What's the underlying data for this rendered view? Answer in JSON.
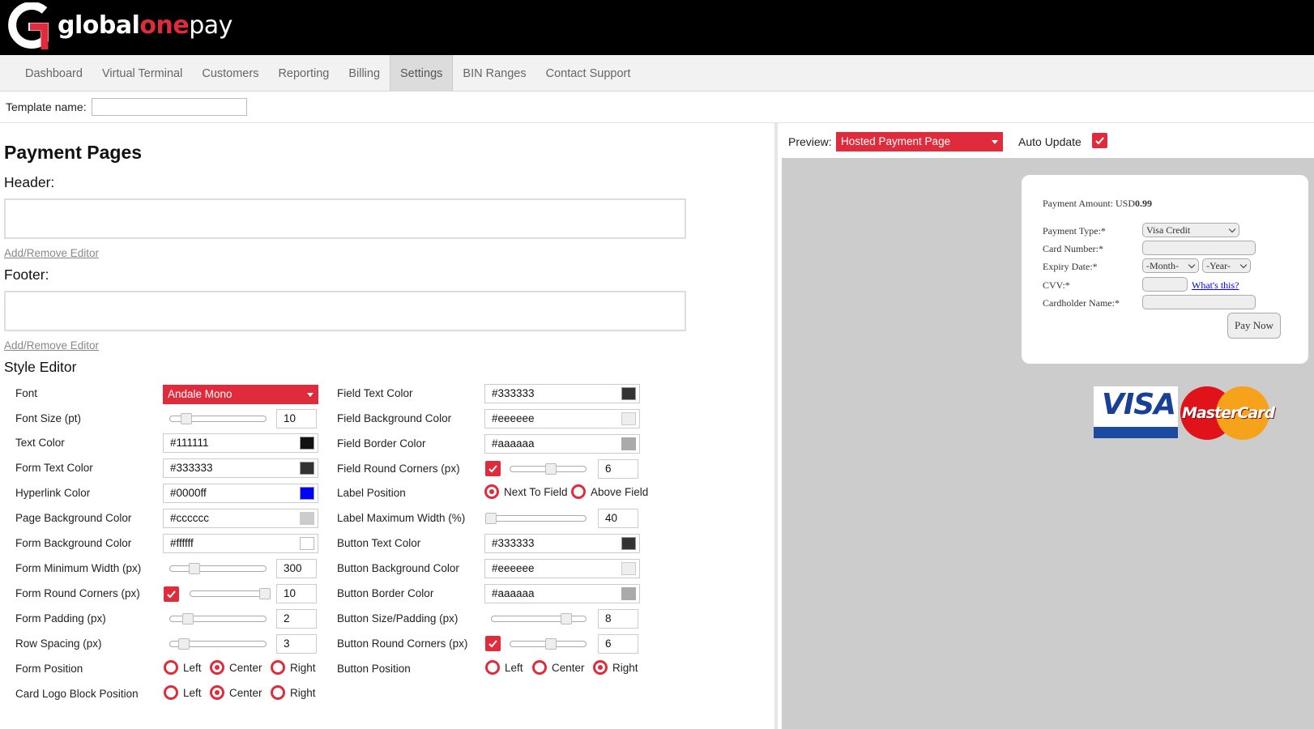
{
  "brand": {
    "part1": "global",
    "part2": "one",
    "part3": "pay",
    "accent": "#e02b3c"
  },
  "nav": {
    "items": [
      "Dashboard",
      "Virtual Terminal",
      "Customers",
      "Reporting",
      "Billing",
      "Settings",
      "BIN Ranges",
      "Contact Support"
    ],
    "active": "Settings"
  },
  "template": {
    "label": "Template name:",
    "value": ""
  },
  "page": {
    "title": "Payment Pages",
    "header_label": "Header:",
    "footer_label": "Footer:",
    "editor_link": "Add/Remove Editor",
    "style_editor_label": "Style Editor"
  },
  "style_left": {
    "font_label": "Font",
    "font_value": "Andale Mono",
    "font_size_label": "Font Size (pt)",
    "font_size_value": "10",
    "text_color_label": "Text Color",
    "text_color_value": "#111111",
    "form_text_color_label": "Form Text Color",
    "form_text_color_value": "#333333",
    "hyperlink_color_label": "Hyperlink Color",
    "hyperlink_color_value": "#0000ff",
    "page_bg_label": "Page Background Color",
    "page_bg_value": "#cccccc",
    "form_bg_label": "Form Background Color",
    "form_bg_value": "#ffffff",
    "form_min_width_label": "Form Minimum Width (px)",
    "form_min_width_value": "300",
    "form_round_label": "Form Round Corners (px)",
    "form_round_value": "10",
    "form_padding_label": "Form Padding (px)",
    "form_padding_value": "2",
    "row_spacing_label": "Row Spacing (px)",
    "row_spacing_value": "3",
    "form_position_label": "Form Position",
    "card_logo_label": "Card Logo Block Position",
    "pos_left": "Left",
    "pos_center": "Center",
    "pos_right": "Right"
  },
  "style_right": {
    "field_text_color_label": "Field Text Color",
    "field_text_color_value": "#333333",
    "field_bg_label": "Field Background Color",
    "field_bg_value": "#eeeeee",
    "field_border_label": "Field Border Color",
    "field_border_value": "#aaaaaa",
    "field_round_label": "Field Round Corners (px)",
    "field_round_value": "6",
    "label_position_label": "Label Position",
    "label_next": "Next To Field",
    "label_above": "Above Field",
    "label_max_width_label": "Label Maximum Width (%)",
    "label_max_width_value": "40",
    "button_text_color_label": "Button Text Color",
    "button_text_color_value": "#333333",
    "button_bg_label": "Button Background Color",
    "button_bg_value": "#eeeeee",
    "button_border_label": "Button Border Color",
    "button_border_value": "#aaaaaa",
    "button_size_label": "Button Size/Padding (px)",
    "button_size_value": "8",
    "button_round_label": "Button Round Corners (px)",
    "button_round_value": "6",
    "button_position_label": "Button Position",
    "pos_left": "Left",
    "pos_center": "Center",
    "pos_right": "Right"
  },
  "preview": {
    "label": "Preview:",
    "select_value": "Hosted Payment Page",
    "auto_update_label": "Auto Update",
    "amount_label": "Payment Amount: USD",
    "amount_value": "0.99",
    "payment_type_label": "Payment Type:*",
    "payment_type_value": "Visa Credit",
    "card_number_label": "Card Number:*",
    "expiry_label": "Expiry Date:*",
    "month_value": "-Month-",
    "year_value": "-Year-",
    "cvv_label": "CVV:*",
    "whats_this": "What's this?",
    "cardholder_label": "Cardholder Name:*",
    "pay_button": "Pay Now",
    "visa_text": "VISA",
    "mastercard_text": "MasterCard"
  }
}
